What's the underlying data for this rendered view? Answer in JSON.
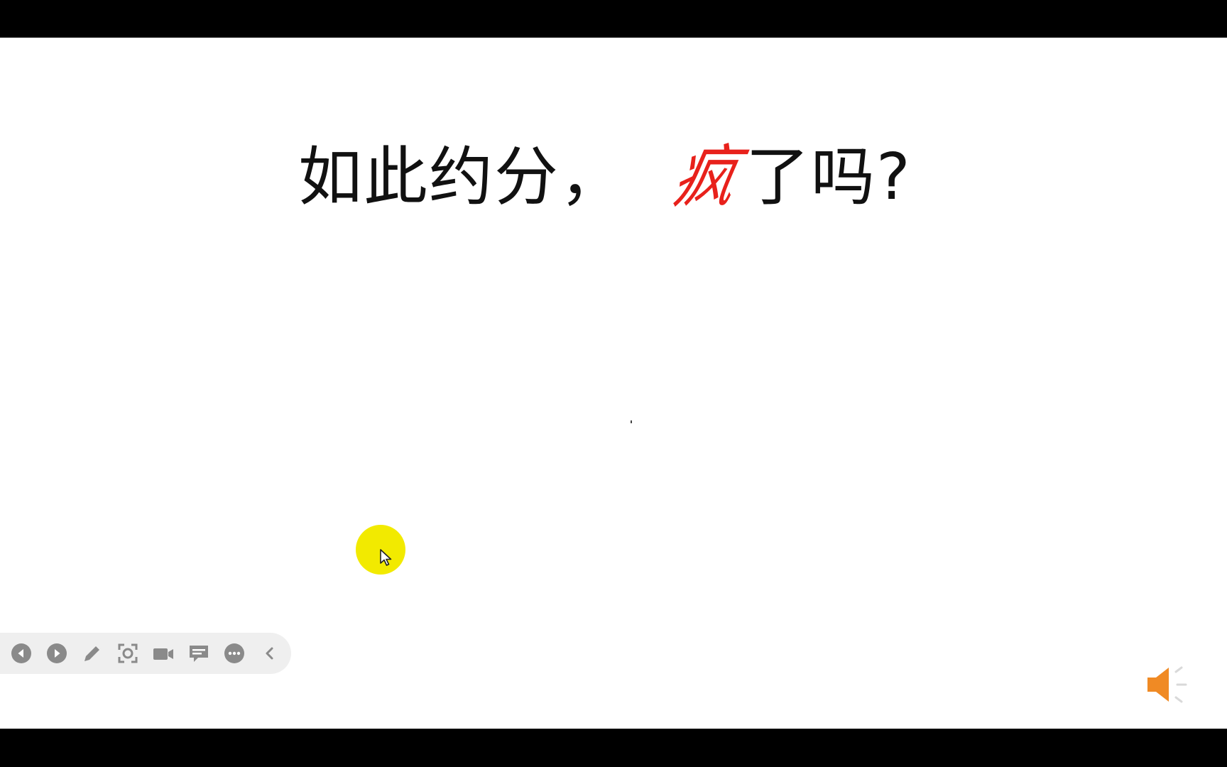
{
  "slide": {
    "title_before": "如此约分",
    "title_comma": "，",
    "title_highlight": "疯",
    "title_after": "了吗?"
  },
  "colors": {
    "highlight_text": "#e8211b",
    "cursor_highlight": "#f2ea00",
    "toolbar_icon": "#8a8a8a",
    "speaker": "#f08a24"
  },
  "toolbar": {
    "buttons": [
      {
        "name": "previous-slide-button",
        "icon": "circle-left-arrow-icon"
      },
      {
        "name": "next-slide-button",
        "icon": "circle-right-arrow-icon"
      },
      {
        "name": "pen-button",
        "icon": "pencil-icon"
      },
      {
        "name": "zoom-button",
        "icon": "focus-frame-icon"
      },
      {
        "name": "video-button",
        "icon": "video-camera-icon"
      },
      {
        "name": "subtitles-button",
        "icon": "speech-bubble-icon"
      },
      {
        "name": "more-options-button",
        "icon": "more-dots-icon"
      },
      {
        "name": "collapse-toolbar-button",
        "icon": "chevron-left-icon"
      }
    ]
  },
  "audio": {
    "icon": "speaker-icon"
  }
}
